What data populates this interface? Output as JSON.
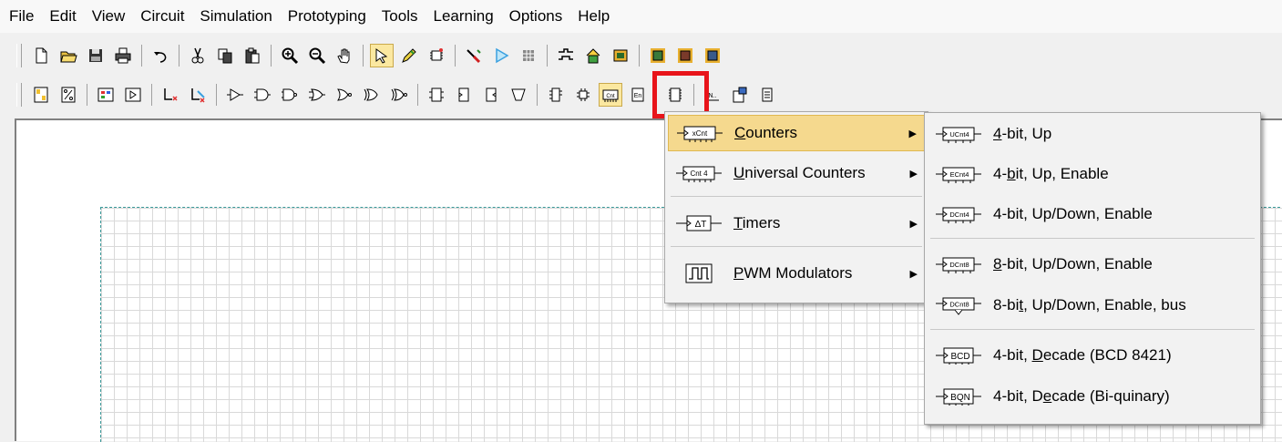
{
  "menubar": [
    "File",
    "Edit",
    "View",
    "Circuit",
    "Simulation",
    "Prototyping",
    "Tools",
    "Learning",
    "Options",
    "Help"
  ],
  "counters_menu": {
    "items": [
      {
        "label": "Counters",
        "u": "C",
        "rest": "ounters",
        "icon": "xCnt"
      },
      {
        "label": "Universal Counters",
        "u": "U",
        "rest": "niversal Counters",
        "icon": "Cnt 4"
      },
      {
        "label": "Timers",
        "u": "T",
        "rest": "imers",
        "icon": "ΔT"
      },
      {
        "label": "PWM Modulators",
        "u": "P",
        "rest": "WM Modulators",
        "icon": "pulse"
      }
    ]
  },
  "counters_submenu": {
    "items": [
      {
        "pre": "",
        "u": "4",
        "post": "-bit, Up",
        "icon": "UCnt4"
      },
      {
        "pre": "4-",
        "u": "b",
        "post": "it, Up, Enable",
        "icon": "ECnt4"
      },
      {
        "pre": "4-bit, Up/Down, Enable",
        "u": "",
        "post": "",
        "icon": "DCnt4"
      },
      {
        "pre": "",
        "u": "8",
        "post": "-bit, Up/Down, Enable",
        "icon": "DCnt8"
      },
      {
        "pre": "8-bi",
        "u": "t",
        "post": ", Up/Down, Enable, bus",
        "icon": "DCnt8"
      },
      {
        "pre": "4-bit, ",
        "u": "D",
        "post": "ecade (BCD 8421)",
        "icon": "BCD"
      },
      {
        "pre": "4-bit, D",
        "u": "e",
        "post": "cade (Bi-quinary)",
        "icon": "BQN"
      }
    ]
  },
  "colors": {
    "highlight": "#e8141a",
    "menu_active": "#f5d98e"
  }
}
